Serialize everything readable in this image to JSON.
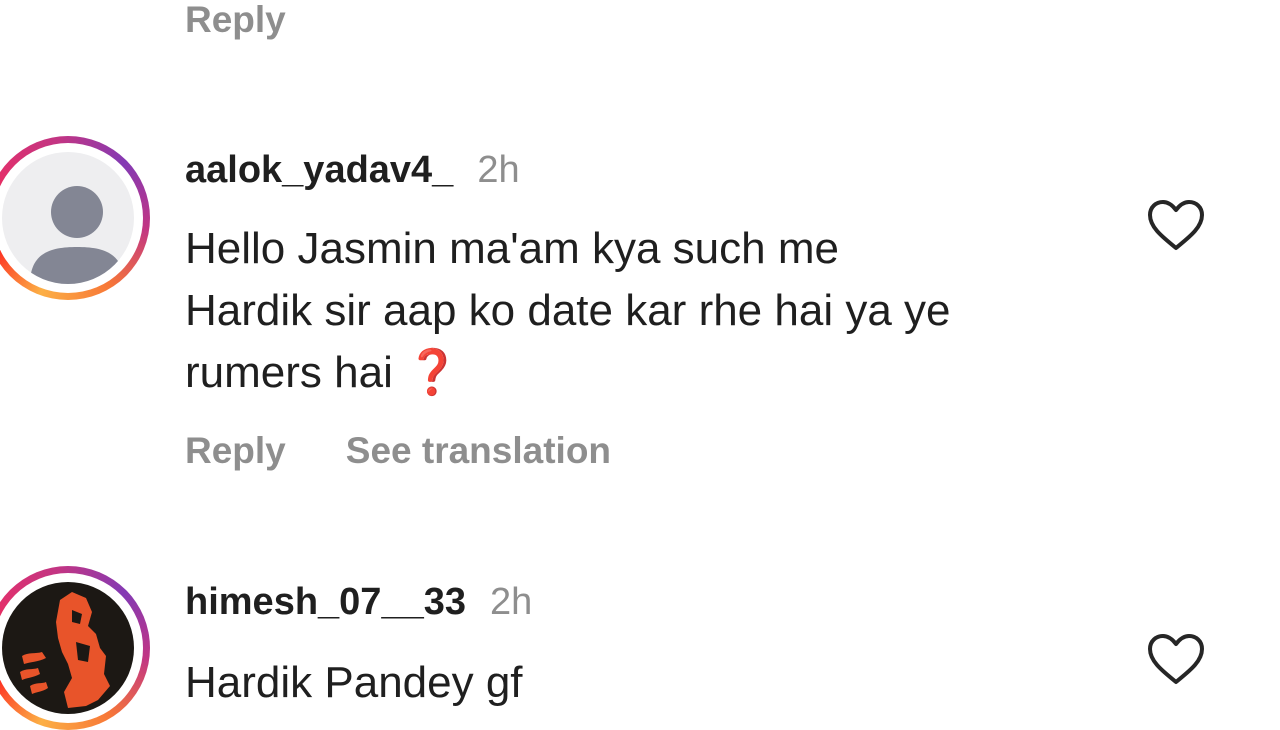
{
  "top_reply_label": "Reply",
  "comments": [
    {
      "username": "aalok_yadav4_",
      "time": "2h",
      "text_lines": [
        "Hello Jasmin ma'am kya such me",
        "Hardik sir aap ko date kar rhe hai ya ye",
        "rumers hai"
      ],
      "emoji": "❓",
      "reply_label": "Reply",
      "translate_label": "See translation",
      "avatar": "default-avatar-icon",
      "liked": false
    },
    {
      "username": "himesh_07__33",
      "time": "2h",
      "text_lines": [
        "Hardik Pandey gf"
      ],
      "avatar": "profile-photo",
      "liked": false
    }
  ],
  "colors": {
    "secondary_text": "#8e8e8e",
    "primary_text": "#1f1f1f",
    "story_ring_start": "#fcaf45",
    "story_ring_end": "#c13584"
  }
}
